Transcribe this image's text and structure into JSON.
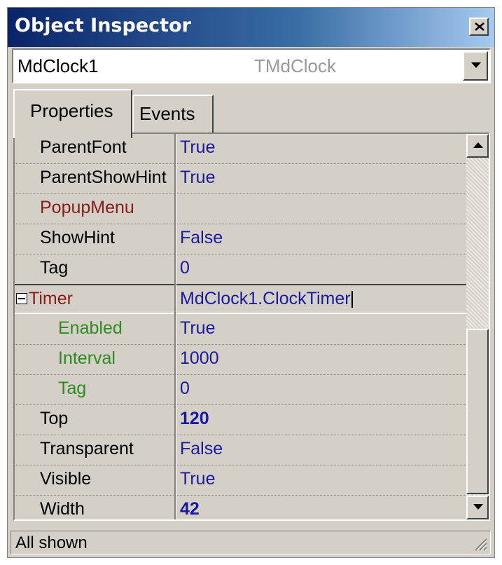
{
  "window": {
    "title": "Object Inspector",
    "close_icon": "close-icon"
  },
  "component_selector": {
    "name": "MdClock1",
    "type": "TMdClock",
    "dropdown_icon": "chevron-down-icon"
  },
  "tabs": [
    {
      "label": "Properties",
      "active": true
    },
    {
      "label": "Events",
      "active": false
    }
  ],
  "properties": [
    {
      "name": "ParentFont",
      "value": "True"
    },
    {
      "name": "ParentShowHint",
      "value": "True"
    },
    {
      "name": "PopupMenu",
      "value": ""
    },
    {
      "name": "ShowHint",
      "value": "False"
    },
    {
      "name": "Tag",
      "value": "0"
    },
    {
      "name": "Timer",
      "value": "MdClock1.ClockTimer"
    },
    {
      "name": "Enabled",
      "value": "True"
    },
    {
      "name": "Interval",
      "value": "1000"
    },
    {
      "name": "Tag",
      "value": "0"
    },
    {
      "name": "Top",
      "value": "120"
    },
    {
      "name": "Transparent",
      "value": "False"
    },
    {
      "name": "Visible",
      "value": "True"
    },
    {
      "name": "Width",
      "value": "42"
    }
  ],
  "colors": {
    "reference_property": "#8b1a1a",
    "subproperty": "#2e8b20",
    "value": "#1a1aa0",
    "title_gradient_start": "#0a246a"
  },
  "status": {
    "text": "All shown"
  }
}
